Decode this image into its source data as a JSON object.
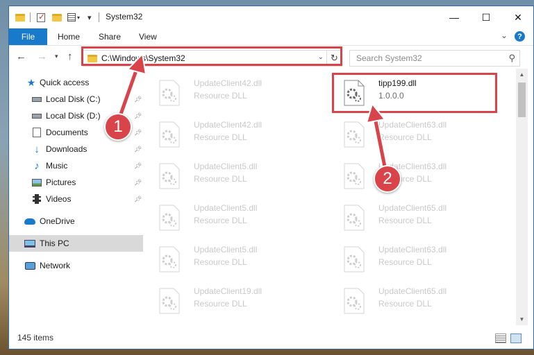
{
  "window": {
    "title": "System32",
    "controls": {
      "minimize": "—",
      "maximize": "☐",
      "close": "✕"
    }
  },
  "ribbon": {
    "tabs": [
      {
        "label": "File"
      },
      {
        "label": "Home"
      },
      {
        "label": "Share"
      },
      {
        "label": "View"
      }
    ],
    "help": "?"
  },
  "navigation": {
    "address": "C:\\Windows\\System32",
    "search_placeholder": "Search System32"
  },
  "sidebar": {
    "items": [
      {
        "label": "Quick access",
        "icon": "star-icon"
      },
      {
        "label": "Local Disk (C:)",
        "icon": "drive-icon",
        "pinned": true
      },
      {
        "label": "Local Disk (D:)",
        "icon": "drive-icon",
        "pinned": true
      },
      {
        "label": "Documents",
        "icon": "documents-icon",
        "pinned": true
      },
      {
        "label": "Downloads",
        "icon": "download-icon",
        "pinned": true
      },
      {
        "label": "Music",
        "icon": "music-icon",
        "pinned": true
      },
      {
        "label": "Pictures",
        "icon": "pictures-icon",
        "pinned": true
      },
      {
        "label": "Videos",
        "icon": "videos-icon",
        "pinned": true
      },
      {
        "label": "OneDrive",
        "icon": "cloud-icon"
      },
      {
        "label": "This PC",
        "icon": "computer-icon",
        "selected": true
      },
      {
        "label": "Network",
        "icon": "network-icon"
      }
    ]
  },
  "files": {
    "left_column": [
      {
        "name": "UpdateClient42.dll",
        "type": "Resource DLL"
      },
      {
        "name": "UpdateClient42.dll",
        "type": "Resource DLL"
      },
      {
        "name": "UpdateClient5.dll",
        "type": "Resource DLL"
      },
      {
        "name": "UpdateClient5.dll",
        "type": "Resource DLL"
      },
      {
        "name": "UpdateClient5.dll",
        "type": "Resource DLL"
      },
      {
        "name": "UpdateClient19.dll",
        "type": "Resource DLL"
      }
    ],
    "right_column": [
      {
        "name": "tipp199.dll",
        "type": "1.0.0.0",
        "selected": true
      },
      {
        "name": "UpdateClient63.dll",
        "type": "Resource DLL"
      },
      {
        "name": "UpdateClient63.dll",
        "type": "Resource DLL"
      },
      {
        "name": "UpdateClient65.dll",
        "type": "Resource DLL"
      },
      {
        "name": "UpdateClient63.dll",
        "type": "Resource DLL"
      },
      {
        "name": "UpdateClient65.dll",
        "type": "Resource DLL"
      }
    ]
  },
  "status": {
    "item_count": "145 items"
  },
  "annotations": {
    "callout_1": "1",
    "callout_2": "2",
    "color": "#d9434a"
  }
}
